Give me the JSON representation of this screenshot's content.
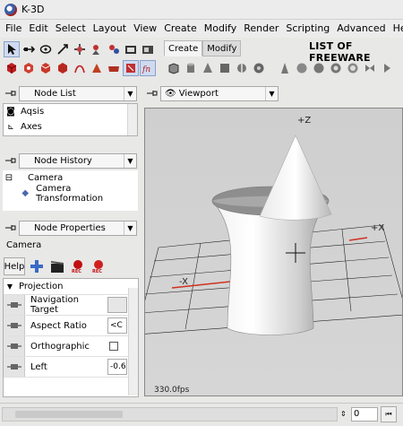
{
  "window": {
    "title": "K-3D"
  },
  "menu": [
    "File",
    "Edit",
    "Select",
    "Layout",
    "View",
    "Create",
    "Modify",
    "Render",
    "Scripting",
    "Advanced",
    "Help"
  ],
  "toolbar": {
    "tabs": [
      {
        "label": "Create",
        "active": true
      },
      {
        "label": "Modify",
        "active": false
      }
    ],
    "banner": "LIST OF FREEWARE",
    "row1_icons": [
      "select-arrow-icon",
      "move-icon",
      "rotate-icon",
      "scale-icon",
      "snap-icon",
      "render-preview-icon",
      "render-frame-icon",
      "render-animation-icon",
      "camera-select-icon",
      "sdl-icon"
    ],
    "row2_icons": [
      "cube-red-icon",
      "cube-front-icon",
      "cube-top-icon",
      "cube-side-icon",
      "curve-icon",
      "light-icon",
      "camera-icon",
      "material-icon",
      "script-icon"
    ],
    "shape_icons": [
      "cube-icon",
      "cylinder-icon",
      "cone-icon",
      "sphere-icon",
      "torus-icon",
      "cone-primitive-icon",
      "disk-icon",
      "sphere-primitive-icon",
      "hyperboloid-icon",
      "paraboloid-icon",
      "torus-primitive-icon",
      "bow-icon",
      "arrow-right-icon"
    ]
  },
  "node_list": {
    "title": "Node List",
    "items": [
      {
        "label": "Aqsis",
        "icon": "render-engine-icon"
      },
      {
        "label": "Axes",
        "icon": "axes-icon"
      }
    ]
  },
  "node_history": {
    "title": "Node History",
    "items": [
      {
        "label": "Camera",
        "level": 0
      },
      {
        "label": "Camera Transformation",
        "level": 1
      }
    ]
  },
  "node_properties": {
    "title": "Node Properties",
    "node_name": "Camera",
    "help_label": "Help",
    "section": "Projection",
    "properties": [
      {
        "label": "Navigation Target",
        "value": ""
      },
      {
        "label": "Aspect Ratio",
        "value": "<C"
      },
      {
        "label": "Orthographic",
        "value": "checkbox"
      },
      {
        "label": "Left",
        "value": "-0.6"
      }
    ]
  },
  "viewport": {
    "title": "Viewport",
    "axis_labels": {
      "pos_z": "+Z",
      "pos_x": "+X",
      "neg_x": "-X"
    },
    "fps": "330.0fps"
  },
  "statusbar": {
    "frame": "0"
  },
  "colors": {
    "accent": "#cfdaf0",
    "axis_red": "#d03020"
  }
}
